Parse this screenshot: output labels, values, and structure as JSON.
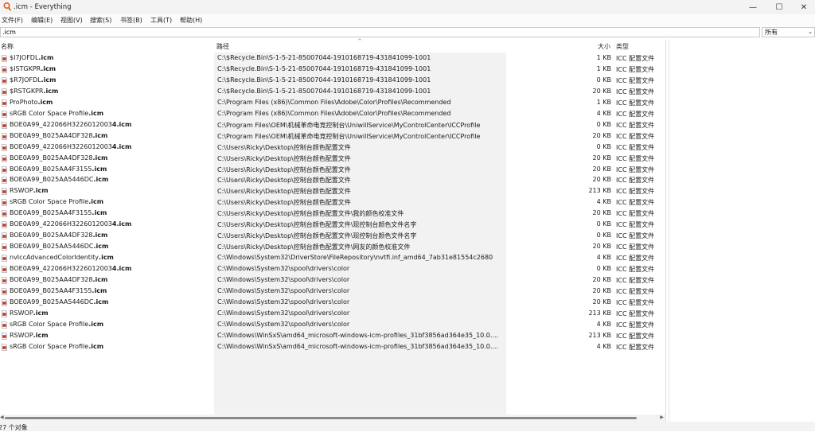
{
  "window": {
    "title": ".icm - Everything",
    "minimize": "—",
    "maximize": "☐",
    "close": "✕"
  },
  "menu": [
    "文件(F)",
    "编辑(E)",
    "视图(V)",
    "搜索(S)",
    "书签(B)",
    "工具(T)",
    "帮助(H)"
  ],
  "search": {
    "value": ".icm",
    "filter": "所有"
  },
  "columns": {
    "name": "名称",
    "path": "路径",
    "size": "大小",
    "type": "类型"
  },
  "rows": [
    {
      "stem": "$I7JOFDL",
      "ext": ".icm",
      "path": "C:\\$Recycle.Bin\\S-1-5-21-85007044-1910168719-431841099-1001",
      "size": "1 KB",
      "type": "ICC 配置文件"
    },
    {
      "stem": "$ISTGKPR",
      "ext": ".icm",
      "path": "C:\\$Recycle.Bin\\S-1-5-21-85007044-1910168719-431841099-1001",
      "size": "1 KB",
      "type": "ICC 配置文件"
    },
    {
      "stem": "$R7JOFDL",
      "ext": ".icm",
      "path": "C:\\$Recycle.Bin\\S-1-5-21-85007044-1910168719-431841099-1001",
      "size": "0 KB",
      "type": "ICC 配置文件"
    },
    {
      "stem": "$RSTGKPR",
      "ext": ".icm",
      "path": "C:\\$Recycle.Bin\\S-1-5-21-85007044-1910168719-431841099-1001",
      "size": "20 KB",
      "type": "ICC 配置文件"
    },
    {
      "stem": "ProPhoto",
      "ext": ".icm",
      "path": "C:\\Program Files (x86)\\Common Files\\Adobe\\Color\\Profiles\\Recommended",
      "size": "1 KB",
      "type": "ICC 配置文件"
    },
    {
      "stem": "sRGB Color Space Profile",
      "ext": ".icm",
      "path": "C:\\Program Files (x86)\\Common Files\\Adobe\\Color\\Profiles\\Recommended",
      "size": "4 KB",
      "type": "ICC 配置文件"
    },
    {
      "stem": "BOE0A99_422066H3226012003",
      "ext": "4.icm",
      "path": "C:\\Program Files\\OEM\\机械革命电竞控制台\\UniwillService\\MyControlCenter\\ICCProfile",
      "size": "0 KB",
      "type": "ICC 配置文件"
    },
    {
      "stem": "BOE0A99_B025AA4DF328",
      "ext": ".icm",
      "path": "C:\\Program Files\\OEM\\机械革命电竞控制台\\UniwillService\\MyControlCenter\\ICCProfile",
      "size": "20 KB",
      "type": "ICC 配置文件"
    },
    {
      "stem": "BOE0A99_422066H3226012003",
      "ext": "4.icm",
      "path": "C:\\Users\\Ricky\\Desktop\\控制台颜色配置文件",
      "size": "0 KB",
      "type": "ICC 配置文件"
    },
    {
      "stem": "BOE0A99_B025AA4DF328",
      "ext": ".icm",
      "path": "C:\\Users\\Ricky\\Desktop\\控制台颜色配置文件",
      "size": "20 KB",
      "type": "ICC 配置文件"
    },
    {
      "stem": "BOE0A99_B025AA4F3155",
      "ext": ".icm",
      "path": "C:\\Users\\Ricky\\Desktop\\控制台颜色配置文件",
      "size": "20 KB",
      "type": "ICC 配置文件"
    },
    {
      "stem": "BOE0A99_B025AA5446DC",
      "ext": ".icm",
      "path": "C:\\Users\\Ricky\\Desktop\\控制台颜色配置文件",
      "size": "20 KB",
      "type": "ICC 配置文件"
    },
    {
      "stem": "RSWOP",
      "ext": ".icm",
      "path": "C:\\Users\\Ricky\\Desktop\\控制台颜色配置文件",
      "size": "213 KB",
      "type": "ICC 配置文件"
    },
    {
      "stem": "sRGB Color Space Profile",
      "ext": ".icm",
      "path": "C:\\Users\\Ricky\\Desktop\\控制台颜色配置文件",
      "size": "4 KB",
      "type": "ICC 配置文件"
    },
    {
      "stem": "BOE0A99_B025AA4F3155",
      "ext": ".icm",
      "path": "C:\\Users\\Ricky\\Desktop\\控制台颜色配置文件\\我的颜色校准文件",
      "size": "20 KB",
      "type": "ICC 配置文件"
    },
    {
      "stem": "BOE0A99_422066H3226012003",
      "ext": "4.icm",
      "path": "C:\\Users\\Ricky\\Desktop\\控制台颜色配置文件\\现控制台颜色文件名字",
      "size": "0 KB",
      "type": "ICC 配置文件"
    },
    {
      "stem": "BOE0A99_B025AA4DF328",
      "ext": ".icm",
      "path": "C:\\Users\\Ricky\\Desktop\\控制台颜色配置文件\\现控制台颜色文件名字",
      "size": "0 KB",
      "type": "ICC 配置文件"
    },
    {
      "stem": "BOE0A99_B025AA5446DC",
      "ext": ".icm",
      "path": "C:\\Users\\Ricky\\Desktop\\控制台颜色配置文件\\网友的颜色校准文件",
      "size": "20 KB",
      "type": "ICC 配置文件"
    },
    {
      "stem": "nvIccAdvancedColorIdentity",
      "ext": ".icm",
      "path": "C:\\Windows\\System32\\DriverStore\\FileRepository\\nvtfi.inf_amd64_7ab31e81554c2680",
      "size": "4 KB",
      "type": "ICC 配置文件"
    },
    {
      "stem": "BOE0A99_422066H3226012003",
      "ext": "4.icm",
      "path": "C:\\Windows\\System32\\spool\\drivers\\color",
      "size": "0 KB",
      "type": "ICC 配置文件"
    },
    {
      "stem": "BOE0A99_B025AA4DF328",
      "ext": ".icm",
      "path": "C:\\Windows\\System32\\spool\\drivers\\color",
      "size": "20 KB",
      "type": "ICC 配置文件"
    },
    {
      "stem": "BOE0A99_B025AA4F3155",
      "ext": ".icm",
      "path": "C:\\Windows\\System32\\spool\\drivers\\color",
      "size": "20 KB",
      "type": "ICC 配置文件"
    },
    {
      "stem": "BOE0A99_B025AA5446DC",
      "ext": ".icm",
      "path": "C:\\Windows\\System32\\spool\\drivers\\color",
      "size": "20 KB",
      "type": "ICC 配置文件"
    },
    {
      "stem": "RSWOP",
      "ext": ".icm",
      "path": "C:\\Windows\\System32\\spool\\drivers\\color",
      "size": "213 KB",
      "type": "ICC 配置文件"
    },
    {
      "stem": "sRGB Color Space Profile",
      "ext": ".icm",
      "path": "C:\\Windows\\System32\\spool\\drivers\\color",
      "size": "4 KB",
      "type": "ICC 配置文件"
    },
    {
      "stem": "RSWOP",
      "ext": ".icm",
      "path": "C:\\Windows\\WinSxS\\amd64_microsoft-windows-icm-profiles_31bf3856ad364e35_10.0....",
      "size": "213 KB",
      "type": "ICC 配置文件"
    },
    {
      "stem": "sRGB Color Space Profile",
      "ext": ".icm",
      "path": "C:\\Windows\\WinSxS\\amd64_microsoft-windows-icm-profiles_31bf3856ad364e35_10.0....",
      "size": "4 KB",
      "type": "ICC 配置文件"
    }
  ],
  "status": "27 个对象",
  "colors": {
    "accent": "#d9621e",
    "path_shade": "#f2f2f2",
    "icon_red": "#c0392b"
  },
  "icons": {
    "app": "everything-app-icon",
    "file": "icc-file-icon"
  }
}
